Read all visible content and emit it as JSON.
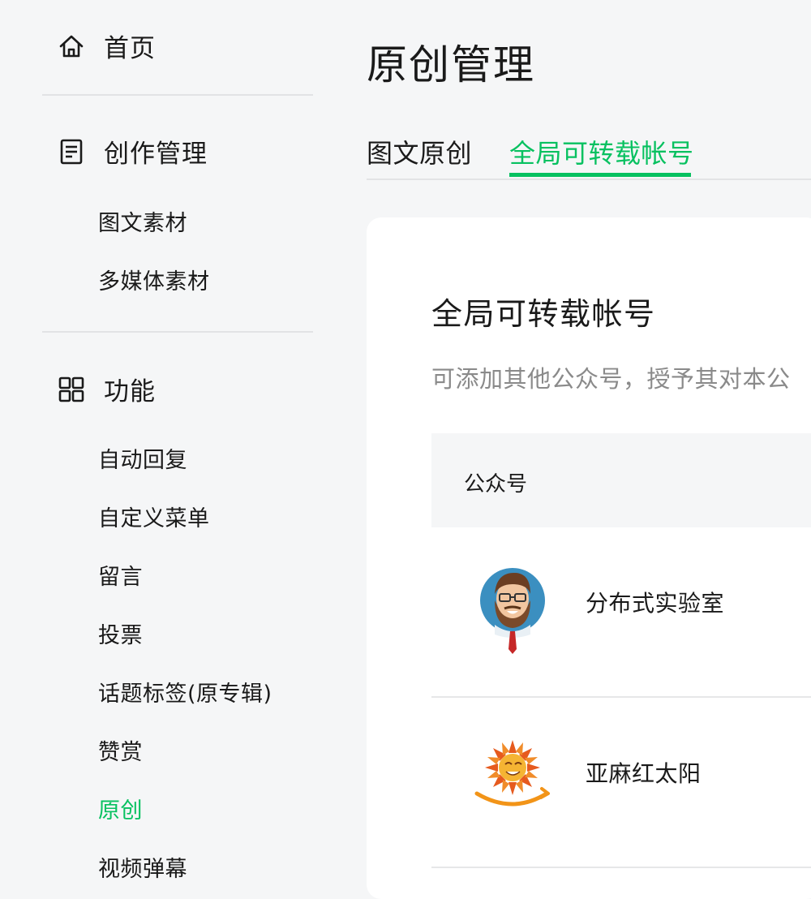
{
  "sidebar": {
    "home": {
      "label": "首页",
      "icon": "home-icon"
    },
    "creation": {
      "label": "创作管理",
      "icon": "document-icon",
      "items": [
        "图文素材",
        "多媒体素材"
      ]
    },
    "features": {
      "label": "功能",
      "icon": "grid-icon",
      "items": [
        "自动回复",
        "自定义菜单",
        "留言",
        "投票",
        "话题标签(原专辑)",
        "赞赏",
        "原创",
        "视频弹幕"
      ],
      "active_item": "原创"
    }
  },
  "main": {
    "title": "原创管理",
    "tabs": [
      {
        "label": "图文原创",
        "active": false
      },
      {
        "label": "全局可转载帐号",
        "active": true
      }
    ],
    "card": {
      "title": "全局可转载帐号",
      "description": "可添加其他公众号，授予其对本公",
      "table": {
        "columns": [
          "公众号"
        ],
        "rows": [
          {
            "name": "分布式实验室",
            "avatar": "cartoon-man-avatar"
          },
          {
            "name": "亚麻红太阳",
            "avatar": "sun-smile-avatar"
          }
        ]
      }
    }
  },
  "colors": {
    "accent": "#07c160",
    "background": "#f5f6f7",
    "card": "#ffffff",
    "muted_text": "#8a8a8a"
  }
}
